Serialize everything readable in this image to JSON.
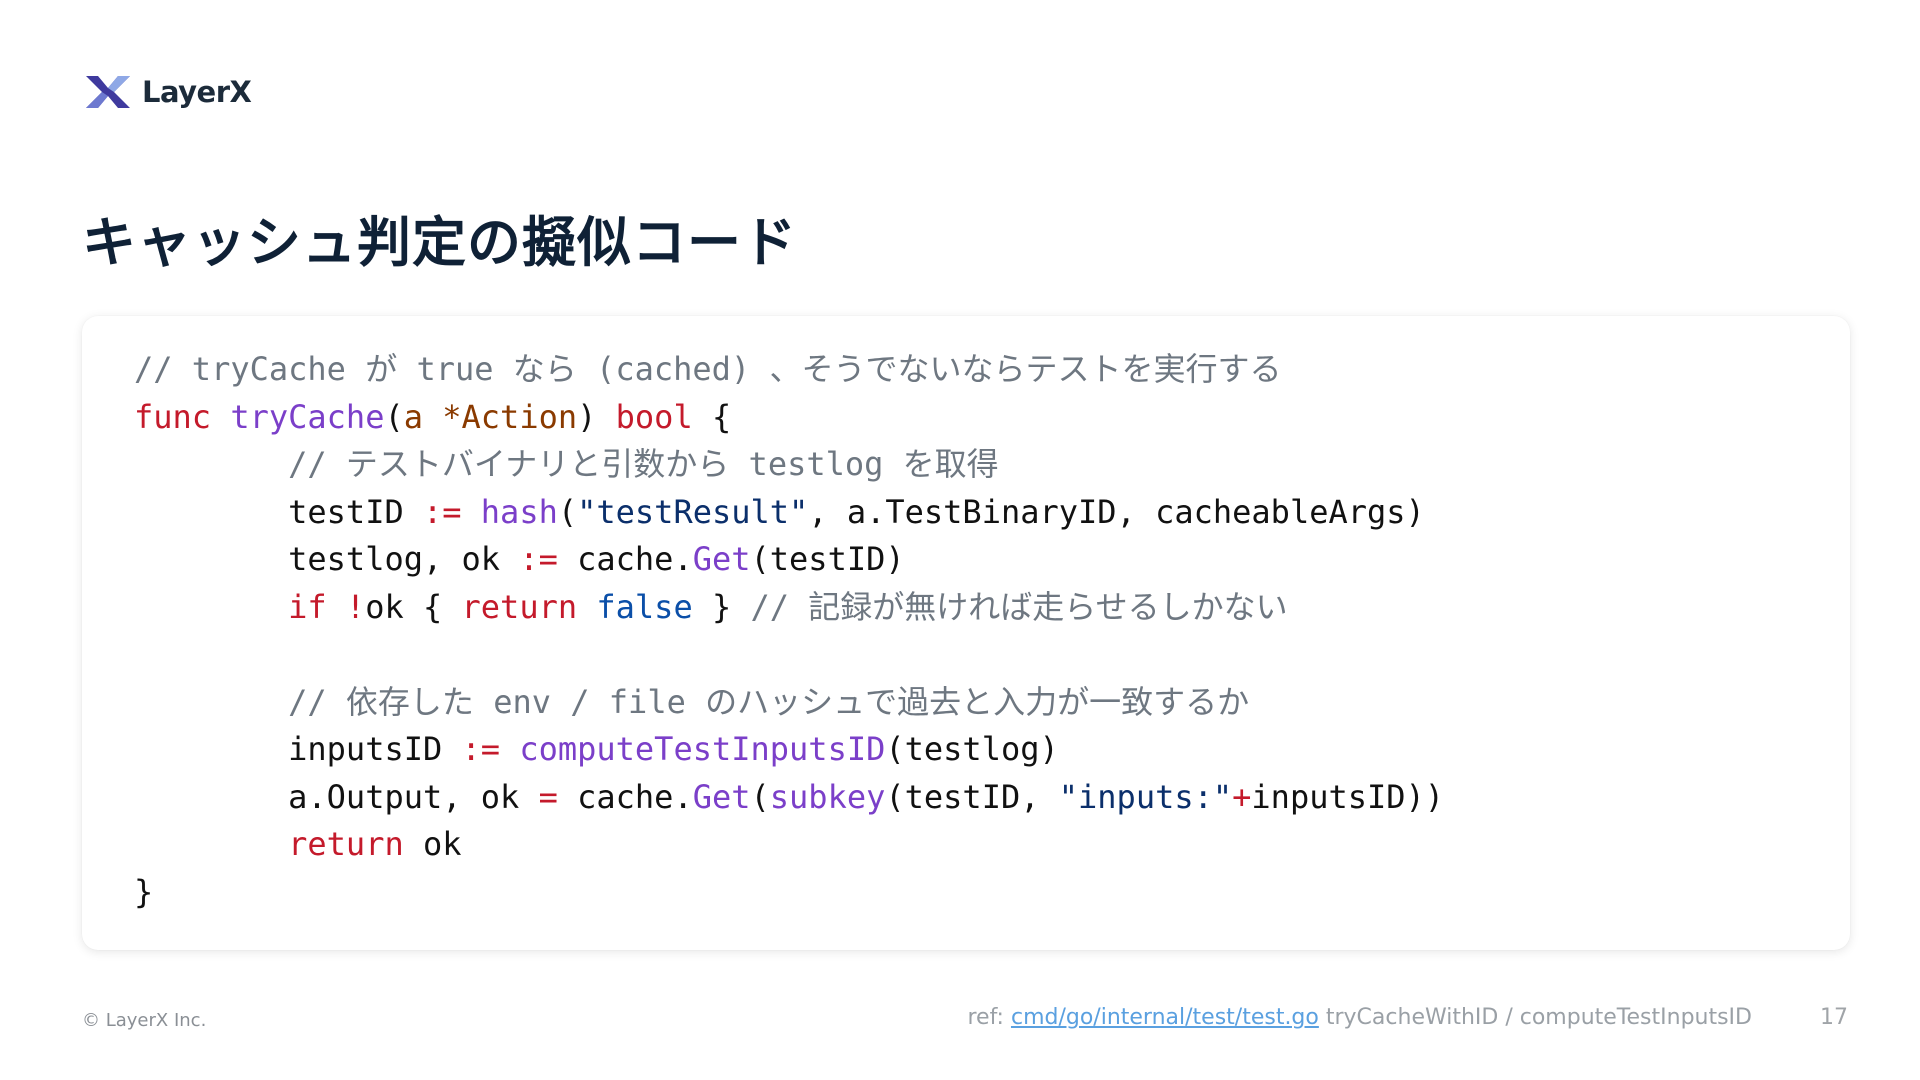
{
  "header": {
    "logo_text": "LayerX",
    "logo_icon": "layerx-logo-icon",
    "brand_colors": {
      "dark": "#3f3a9e",
      "light": "#8fa8e6"
    }
  },
  "slide": {
    "title": "キャッシュ判定の擬似コード",
    "page_number": "17"
  },
  "code": {
    "language": "go",
    "lines": [
      [
        {
          "c": "cm",
          "t": "// tryCache が true なら (cached) 、そうでないならテストを実行する"
        }
      ],
      [
        {
          "c": "kw",
          "t": "func"
        },
        {
          "c": "tx",
          "t": " "
        },
        {
          "c": "fn",
          "t": "tryCache"
        },
        {
          "c": "tx",
          "t": "("
        },
        {
          "c": "par",
          "t": "a *Action"
        },
        {
          "c": "tx",
          "t": ") "
        },
        {
          "c": "kw",
          "t": "bool"
        },
        {
          "c": "tx",
          "t": " {"
        }
      ],
      [
        {
          "c": "tx",
          "t": "        "
        },
        {
          "c": "cm",
          "t": "// テストバイナリと引数から testlog を取得"
        }
      ],
      [
        {
          "c": "tx",
          "t": "        testID "
        },
        {
          "c": "op",
          "t": ":="
        },
        {
          "c": "tx",
          "t": " "
        },
        {
          "c": "fn",
          "t": "hash"
        },
        {
          "c": "tx",
          "t": "("
        },
        {
          "c": "str",
          "t": "\"testResult\""
        },
        {
          "c": "tx",
          "t": ", a.TestBinaryID, cacheableArgs)"
        }
      ],
      [
        {
          "c": "tx",
          "t": "        testlog, ok "
        },
        {
          "c": "op",
          "t": ":="
        },
        {
          "c": "tx",
          "t": " cache."
        },
        {
          "c": "fn",
          "t": "Get"
        },
        {
          "c": "tx",
          "t": "(testID)"
        }
      ],
      [
        {
          "c": "tx",
          "t": "        "
        },
        {
          "c": "kw",
          "t": "if"
        },
        {
          "c": "tx",
          "t": " "
        },
        {
          "c": "op",
          "t": "!"
        },
        {
          "c": "tx",
          "t": "ok { "
        },
        {
          "c": "kw",
          "t": "return"
        },
        {
          "c": "tx",
          "t": " "
        },
        {
          "c": "bool",
          "t": "false"
        },
        {
          "c": "tx",
          "t": " } "
        },
        {
          "c": "cm",
          "t": "// 記録が無ければ走らせるしかない"
        }
      ],
      [
        {
          "c": "tx",
          "t": ""
        }
      ],
      [
        {
          "c": "tx",
          "t": "        "
        },
        {
          "c": "cm",
          "t": "// 依存した env / file のハッシュで過去と入力が一致するか"
        }
      ],
      [
        {
          "c": "tx",
          "t": "        inputsID "
        },
        {
          "c": "op",
          "t": ":="
        },
        {
          "c": "tx",
          "t": " "
        },
        {
          "c": "fn",
          "t": "computeTestInputsID"
        },
        {
          "c": "tx",
          "t": "(testlog)"
        }
      ],
      [
        {
          "c": "tx",
          "t": "        a.Output, ok "
        },
        {
          "c": "op",
          "t": "="
        },
        {
          "c": "tx",
          "t": " cache."
        },
        {
          "c": "fn",
          "t": "Get"
        },
        {
          "c": "tx",
          "t": "("
        },
        {
          "c": "fn",
          "t": "subkey"
        },
        {
          "c": "tx",
          "t": "(testID, "
        },
        {
          "c": "str",
          "t": "\"inputs:\""
        },
        {
          "c": "op",
          "t": "+"
        },
        {
          "c": "tx",
          "t": "inputsID))"
        }
      ],
      [
        {
          "c": "tx",
          "t": "        "
        },
        {
          "c": "kw",
          "t": "return"
        },
        {
          "c": "tx",
          "t": " ok"
        }
      ],
      [
        {
          "c": "tx",
          "t": "}"
        }
      ]
    ]
  },
  "footer": {
    "copyright": "© LayerX Inc.",
    "ref_prefix": "ref: ",
    "ref_link": "cmd/go/internal/test/test.go",
    "ref_suffix": " tryCacheWithID / computeTestInputsID"
  }
}
